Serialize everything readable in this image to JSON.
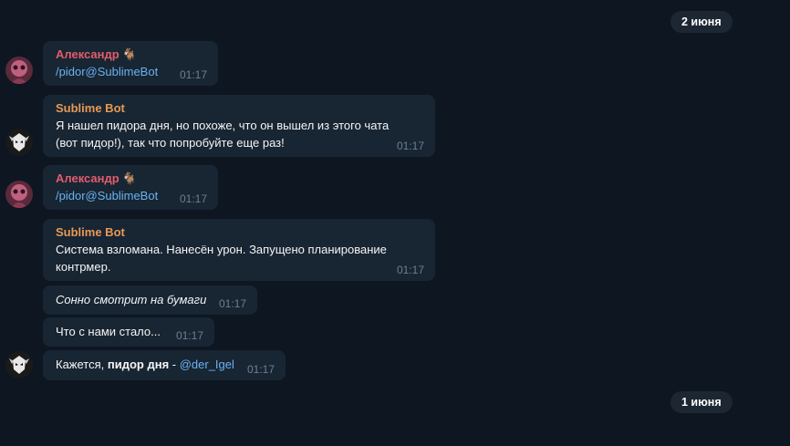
{
  "dates": {
    "top": "2 июня",
    "bottom": "1 июня"
  },
  "messages": [
    {
      "sender": "Александр",
      "sender_emoji": "🐐",
      "text": "/pidor@SublimeBot",
      "time": "01:17"
    },
    {
      "sender": "Sublime Bot",
      "text_line1": "Я нашел пидора дня, но похоже, что он вышел из этого чата",
      "text_line2": "(вот пидор!), так что попробуйте еще раз!",
      "time": "01:17"
    },
    {
      "sender": "Александр",
      "sender_emoji": "🐐",
      "text": "/pidor@SublimeBot",
      "time": "01:17"
    },
    {
      "sender": "Sublime Bot",
      "text_line1": "Система взломана. Нанесён урон. Запущено планирование",
      "text_line2": "контрмер.",
      "time": "01:17"
    },
    {
      "text": "Сонно смотрит на бумаги",
      "time": "01:17"
    },
    {
      "text": "Что с нами стало...",
      "time": "01:17"
    },
    {
      "text_prefix": "Кажется, ",
      "text_bold": "пидор дня",
      "text_sep": " - ",
      "mention": "@der_Igel",
      "time": "01:17"
    }
  ],
  "colors": {
    "background": "#0e1621",
    "bubble": "#182533",
    "alex_name": "#e25d6c",
    "bot_name": "#e69a54",
    "link": "#6ab2f2"
  }
}
